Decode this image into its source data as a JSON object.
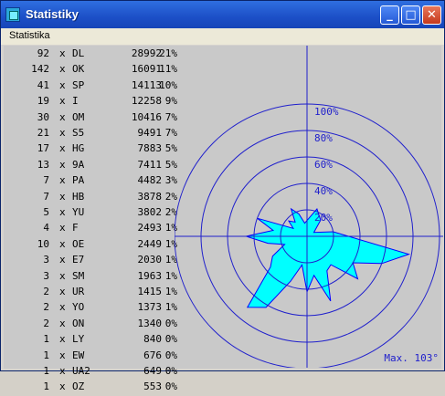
{
  "window": {
    "title": "Statistiky"
  },
  "menu": {
    "items": [
      "Statistika"
    ]
  },
  "stats_table": {
    "rows": [
      {
        "count": "92",
        "x": "x",
        "call": "DL",
        "value": "28992",
        "pct": "21%"
      },
      {
        "count": "142",
        "x": "x",
        "call": "OK",
        "value": "16091",
        "pct": "11%"
      },
      {
        "count": "41",
        "x": "x",
        "call": "SP",
        "value": "14113",
        "pct": "10%"
      },
      {
        "count": "19",
        "x": "x",
        "call": "I",
        "value": "12258",
        "pct": "9%"
      },
      {
        "count": "30",
        "x": "x",
        "call": "OM",
        "value": "10416",
        "pct": "7%"
      },
      {
        "count": "21",
        "x": "x",
        "call": "S5",
        "value": "9491",
        "pct": "7%"
      },
      {
        "count": "17",
        "x": "x",
        "call": "HG",
        "value": "7883",
        "pct": "5%"
      },
      {
        "count": "13",
        "x": "x",
        "call": "9A",
        "value": "7411",
        "pct": "5%"
      },
      {
        "count": "7",
        "x": "x",
        "call": "PA",
        "value": "4482",
        "pct": "3%"
      },
      {
        "count": "7",
        "x": "x",
        "call": "HB",
        "value": "3878",
        "pct": "2%"
      },
      {
        "count": "5",
        "x": "x",
        "call": "YU",
        "value": "3802",
        "pct": "2%"
      },
      {
        "count": "4",
        "x": "x",
        "call": "F",
        "value": "2493",
        "pct": "1%"
      },
      {
        "count": "10",
        "x": "x",
        "call": "OE",
        "value": "2449",
        "pct": "1%"
      },
      {
        "count": "3",
        "x": "x",
        "call": "E7",
        "value": "2030",
        "pct": "1%"
      },
      {
        "count": "3",
        "x": "x",
        "call": "SM",
        "value": "1963",
        "pct": "1%"
      },
      {
        "count": "2",
        "x": "x",
        "call": "UR",
        "value": "1415",
        "pct": "1%"
      },
      {
        "count": "2",
        "x": "x",
        "call": "YO",
        "value": "1373",
        "pct": "1%"
      },
      {
        "count": "2",
        "x": "x",
        "call": "ON",
        "value": "1340",
        "pct": "0%"
      },
      {
        "count": "1",
        "x": "x",
        "call": "LY",
        "value": "840",
        "pct": "0%"
      },
      {
        "count": "1",
        "x": "x",
        "call": "EW",
        "value": "676",
        "pct": "0%"
      },
      {
        "count": "1",
        "x": "x",
        "call": "UA2",
        "value": "649",
        "pct": "0%"
      },
      {
        "count": "1",
        "x": "x",
        "call": "OZ",
        "value": "553",
        "pct": "0%"
      }
    ]
  },
  "chart_data": {
    "type": "polar-area",
    "ring_labels": [
      "20%",
      "40%",
      "60%",
      "80%",
      "100%"
    ],
    "max_label": "Max. 103°",
    "colors": {
      "axes": "#2020cc",
      "fill": "#00ffff",
      "outline": "#0000ff"
    },
    "directions_deg": [
      0,
      20,
      40,
      60,
      80,
      100,
      110,
      120,
      130,
      140,
      150,
      160,
      170,
      180,
      190,
      200,
      210,
      220,
      230,
      240,
      250,
      260,
      270,
      280,
      290,
      300,
      310,
      320,
      330,
      340,
      350
    ],
    "values_pct": [
      12,
      22,
      16,
      6,
      20,
      78,
      60,
      40,
      50,
      28,
      30,
      52,
      30,
      42,
      22,
      36,
      62,
      70,
      36,
      30,
      18,
      30,
      46,
      26,
      40,
      12,
      18,
      14,
      24,
      18,
      10
    ]
  }
}
